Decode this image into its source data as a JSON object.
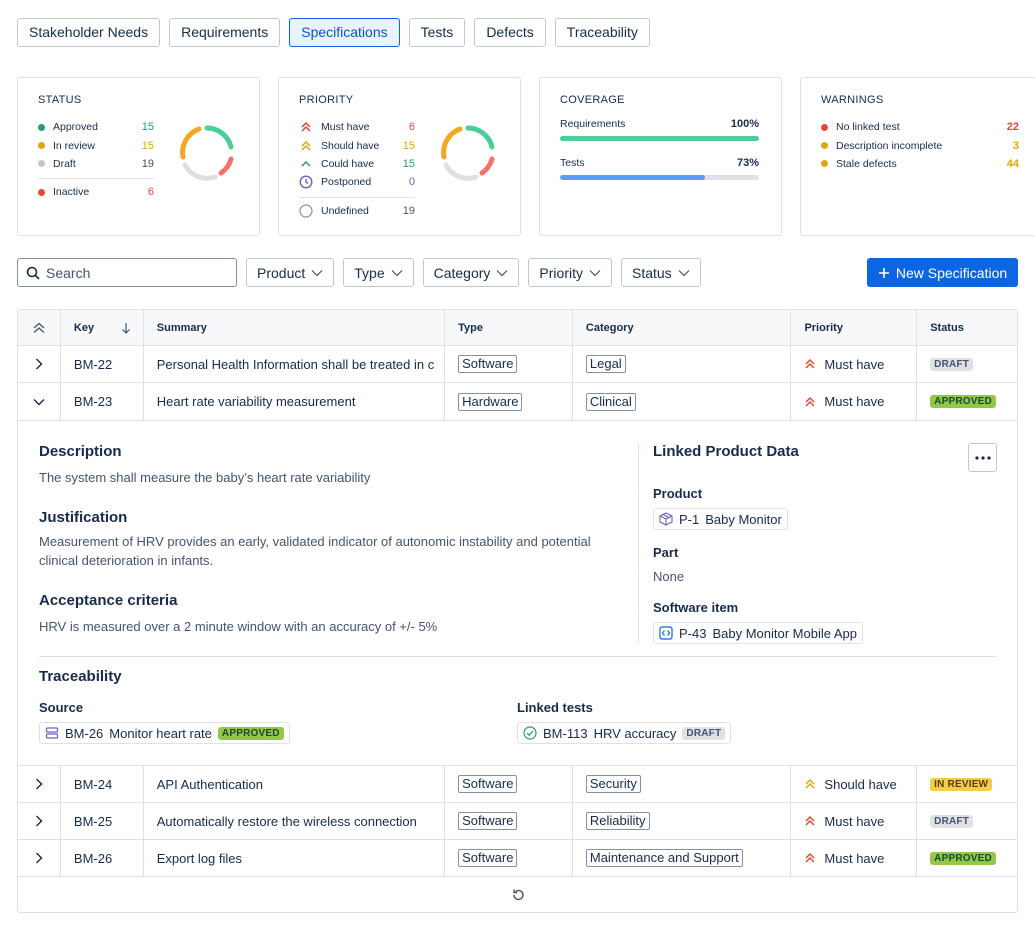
{
  "tabs": [
    "Stakeholder Needs",
    "Requirements",
    "Specifications",
    "Tests",
    "Defects",
    "Traceability"
  ],
  "active_tab": "Specifications",
  "cards": {
    "status": {
      "title": "STATUS",
      "rows": [
        {
          "label": "Approved",
          "value": "15",
          "color": "#22a06b"
        },
        {
          "label": "In review",
          "value": "15",
          "color": "#e2a808"
        },
        {
          "label": "Draft",
          "value": "19",
          "color": "#c1c7d0"
        }
      ],
      "extra": {
        "label": "Inactive",
        "value": "6",
        "color": "#e34935"
      }
    },
    "priority": {
      "title": "PRIORITY",
      "rows": [
        {
          "label": "Must have",
          "value": "6",
          "color": "#e34935"
        },
        {
          "label": "Should have",
          "value": "15",
          "color": "#e2a808"
        },
        {
          "label": "Could have",
          "value": "15",
          "color": "#22a06b"
        },
        {
          "label": "Postponed",
          "value": "0",
          "color": "#6e5dc6"
        }
      ],
      "extra": {
        "label": "Undefined",
        "value": "19",
        "color": "#8590a2"
      }
    },
    "coverage": {
      "title": "COVERAGE",
      "rows": [
        {
          "label": "Requirements",
          "value": "100%",
          "fraction": 1.0,
          "color": "#4bce97"
        },
        {
          "label": "Tests",
          "value": "73%",
          "fraction": 0.73,
          "color": "#579dff"
        }
      ]
    },
    "warnings": {
      "title": "WARNINGS",
      "rows": [
        {
          "label": "No linked test",
          "value": "22",
          "color": "#e34935"
        },
        {
          "label": "Description incomplete",
          "value": "3",
          "color": "#e2a808"
        },
        {
          "label": "Stale defects",
          "value": "44",
          "color": "#e2a808"
        }
      ]
    }
  },
  "search": {
    "placeholder": "Search"
  },
  "filters": [
    "Product",
    "Type",
    "Category",
    "Priority",
    "Status"
  ],
  "new_button": "New Specification",
  "table": {
    "headers": {
      "key": "Key",
      "summary": "Summary",
      "type": "Type",
      "category": "Category",
      "priority": "Priority",
      "status": "Status"
    },
    "rows": [
      {
        "key": "BM-22",
        "summary": "Personal Health Information shall be treated in c",
        "type": "Software",
        "category": "Legal",
        "priority": "Must have",
        "priority_level": "must",
        "status": "DRAFT",
        "status_kind": "draft",
        "expanded": false
      },
      {
        "key": "BM-23",
        "summary": "Heart rate variability measurement",
        "type": "Hardware",
        "category": "Clinical",
        "priority": "Must have",
        "priority_level": "must",
        "status": "APPROVED",
        "status_kind": "approved",
        "expanded": true
      },
      {
        "key": "BM-24",
        "summary": "API Authentication",
        "type": "Software",
        "category": "Security",
        "priority": "Should have",
        "priority_level": "should",
        "status": "IN REVIEW",
        "status_kind": "review",
        "expanded": false
      },
      {
        "key": "BM-25",
        "summary": "Automatically restore the wireless connection",
        "type": "Software",
        "category": "Reliability",
        "priority": "Must have",
        "priority_level": "must",
        "status": "DRAFT",
        "status_kind": "draft",
        "expanded": false
      },
      {
        "key": "BM-26",
        "summary": "Export log files",
        "type": "Software",
        "category": "Maintenance and Support",
        "priority": "Must have",
        "priority_level": "must",
        "status": "APPROVED",
        "status_kind": "approved",
        "expanded": false
      }
    ]
  },
  "detail": {
    "description_h": "Description",
    "description": "The system shall measure the baby’s heart rate variability",
    "justification_h": "Justification",
    "justification_1": "Measurement of HRV provides an early, validated indicator of autonomic instability and potential",
    "justification_2": "clinical deterioration in infants.",
    "acceptance_h": "Acceptance criteria",
    "acceptance": "HRV is measured over a 2 minute window with an accuracy of +/- 5%",
    "linked_h": "Linked Product Data",
    "product_h": "Product",
    "product_key": "P-1",
    "product_name": "Baby Monitor",
    "part_h": "Part",
    "part_value": "None",
    "software_h": "Software item",
    "software_key": "P-43",
    "software_name": "Baby Monitor Mobile App",
    "traceability_h": "Traceability",
    "source_h": "Source",
    "source_key": "BM-26",
    "source_name": "Monitor heart rate",
    "source_status": "APPROVED",
    "tests_h": "Linked tests",
    "test_key": "BM-113",
    "test_name": "HRV accuracy",
    "test_status": "DRAFT"
  }
}
